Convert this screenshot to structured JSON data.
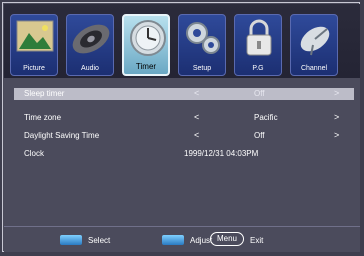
{
  "tabs": [
    {
      "label": "Picture",
      "icon": "picture-icon",
      "active": false
    },
    {
      "label": "Audio",
      "icon": "audio-icon",
      "active": false
    },
    {
      "label": "Timer",
      "icon": "timer-icon",
      "active": true
    },
    {
      "label": "Setup",
      "icon": "setup-icon",
      "active": false
    },
    {
      "label": "P.G",
      "icon": "lock-icon",
      "active": false
    },
    {
      "label": "Channel",
      "icon": "satellite-dish-icon",
      "active": false
    }
  ],
  "settings": [
    {
      "label": "Sleep timer",
      "value": "Off",
      "prev": "<",
      "next": ">",
      "selected": true
    },
    {
      "label": "Time zone",
      "value": "Pacific",
      "prev": "<",
      "next": ">",
      "selected": false
    },
    {
      "label": "Daylight Saving Time",
      "value": "Off",
      "prev": "<",
      "next": ">",
      "selected": false
    },
    {
      "label": "Clock",
      "value": "1999/12/31 04:03PM",
      "prev": "",
      "next": "",
      "selected": false
    }
  ],
  "footer": {
    "select_label": "Select",
    "adjust_label": "Adjust",
    "menu_key": "Menu",
    "exit_label": "Exit"
  },
  "colors": {
    "accent": "#6aa8c4",
    "tab_bg": "#2f4a9a",
    "panel_bg": "#4b4b5c",
    "selected_row": "#bcbcc8"
  }
}
